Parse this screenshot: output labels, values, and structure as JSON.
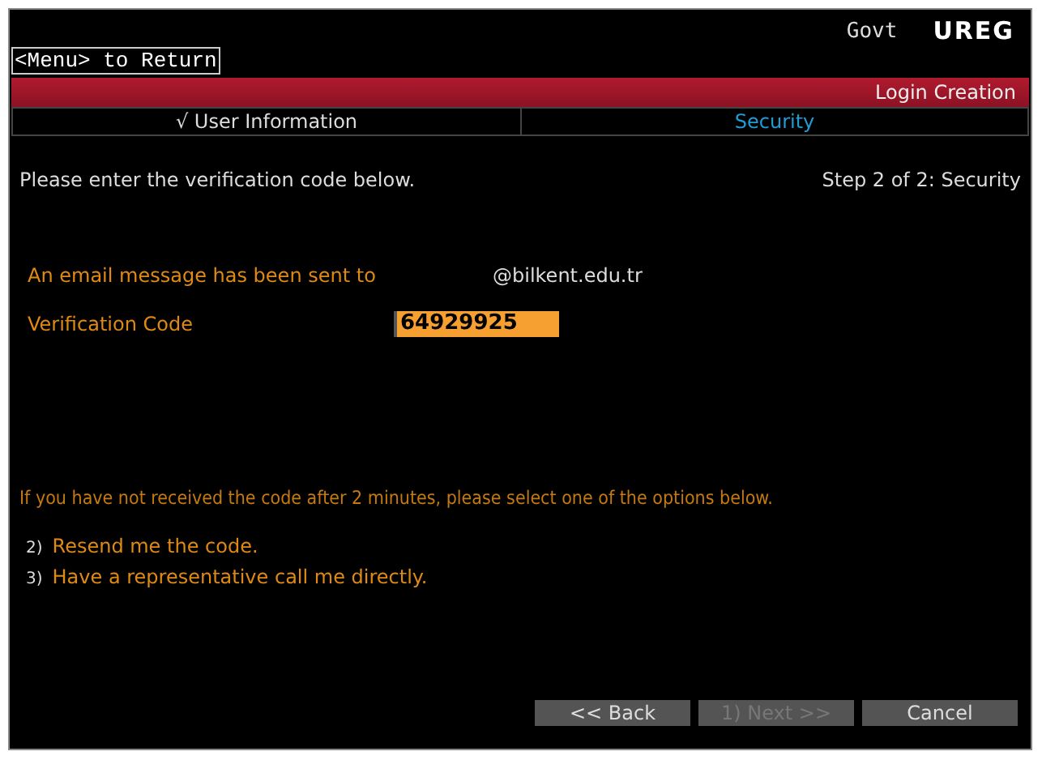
{
  "header": {
    "govt": "Govt",
    "app": "UREG",
    "menu_hint": "<Menu> to Return"
  },
  "banner": {
    "title": "Login Creation"
  },
  "tabs": [
    {
      "mark": "√",
      "label": "User Information",
      "selected": false
    },
    {
      "label": "Security",
      "selected": true
    }
  ],
  "instruction": "Please enter the verification code below.",
  "step": "Step 2 of 2: Security",
  "email": {
    "label": "An email message has been sent to",
    "value": "@bilkent.edu.tr"
  },
  "code": {
    "label": "Verification Code",
    "value": "64929925"
  },
  "notice": "If you have not received the code after 2 minutes, please select one of the options below.",
  "options": [
    {
      "number": "2)",
      "text": "Resend me the code."
    },
    {
      "number": "3)",
      "text": "Have a representative call me directly."
    }
  ],
  "buttons": [
    {
      "label": "<< Back",
      "disabled": false
    },
    {
      "label": "1) Next >>",
      "disabled": true
    },
    {
      "label": "Cancel",
      "disabled": false
    }
  ]
}
